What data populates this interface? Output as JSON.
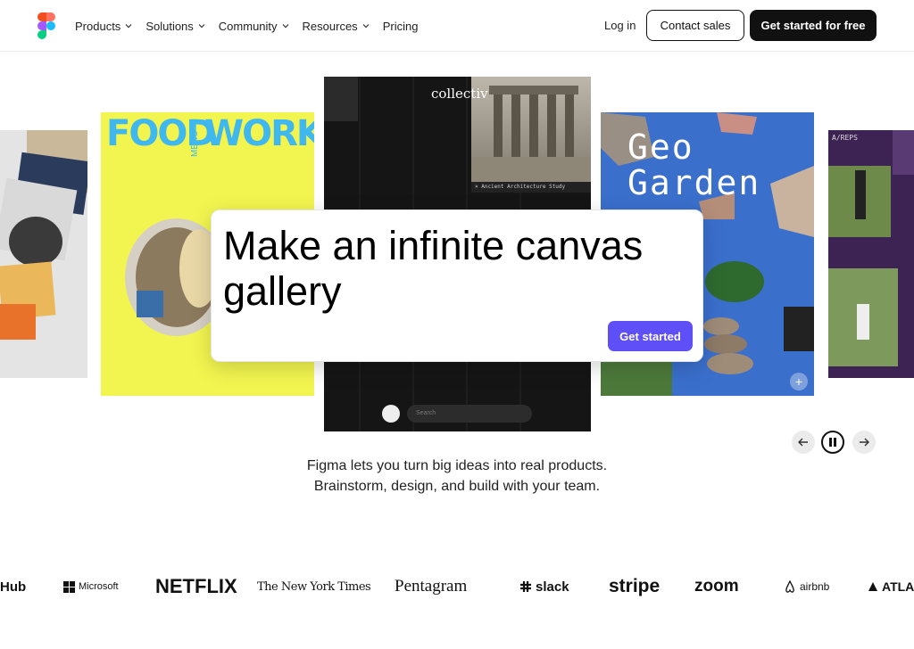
{
  "nav": {
    "menu": [
      {
        "label": "Products",
        "dropdown": true
      },
      {
        "label": "Solutions",
        "dropdown": true
      },
      {
        "label": "Community",
        "dropdown": true
      },
      {
        "label": "Resources",
        "dropdown": true
      },
      {
        "label": "Pricing",
        "dropdown": false
      }
    ],
    "login": "Log in",
    "contact": "Contact sales",
    "cta": "Get started for free"
  },
  "carousel": {
    "food_title_left": "FOOD",
    "food_title_right": "WORKS",
    "food_menu": "MENU",
    "collectiv_word": "collectiv",
    "ancient_label": "× Ancient Architecture Study",
    "collectiv_search_placeholder": "Search",
    "geo_title_line1": "Geo",
    "geo_title_line2": "Garden",
    "areps_label": "A/REPS",
    "plus": "+"
  },
  "hero": {
    "title": "Make an infinite canvas gallery",
    "button": "Get started"
  },
  "tagline": {
    "line1": "Figma lets you turn big ideas into real products.",
    "line2": "Brainstorm, design, and build with your team."
  },
  "logos": [
    "Hub",
    "Microsoft",
    "NETFLIX",
    "The New York Times",
    "Pentagram",
    "slack",
    "stripe",
    "zoom",
    "airbnb",
    "ATLA"
  ],
  "colors": {
    "accent": "#5f4ff7",
    "dark": "#111111",
    "food_bg": "#f2f54f",
    "food_text": "#3fb7ef",
    "geo_bg": "#3a6fcc"
  }
}
